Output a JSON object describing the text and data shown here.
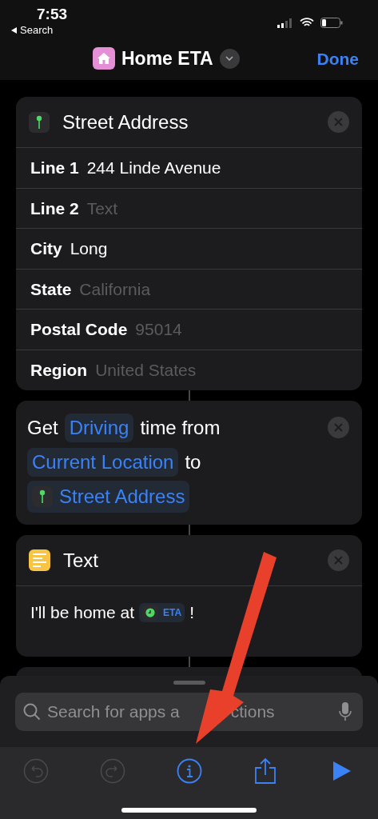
{
  "status_bar": {
    "time": "7:53",
    "back": "Search"
  },
  "nav": {
    "title": "Home ETA",
    "done": "Done"
  },
  "address_card": {
    "title": "Street Address",
    "rows": [
      {
        "label": "Line 1",
        "value": "244 Linde Avenue"
      },
      {
        "label": "Line 2",
        "placeholder": "Text"
      },
      {
        "label": "City",
        "value": "Long"
      },
      {
        "label": "State",
        "placeholder": "California"
      },
      {
        "label": "Postal Code",
        "placeholder": "95014"
      },
      {
        "label": "Region",
        "placeholder": "United States"
      }
    ]
  },
  "travel_card": {
    "lines": [
      [
        {
          "kind": "text",
          "text": "Get"
        },
        {
          "kind": "param",
          "text": "Driving"
        },
        {
          "kind": "text",
          "text": "time from"
        }
      ],
      [
        {
          "kind": "param",
          "text": "Current Location"
        },
        {
          "kind": "text",
          "text": "to"
        }
      ],
      [
        {
          "kind": "variable",
          "text": "Street Address"
        }
      ]
    ]
  },
  "text_card": {
    "title": "Text",
    "body": "I'll be home at",
    "token": "ETA",
    "after": "!"
  },
  "search": {
    "placeholder_visible": [
      "Search for apps a",
      "ctions"
    ]
  },
  "toolbar": [
    {
      "kind": "undo",
      "disabled": true
    },
    {
      "kind": "redo",
      "disabled": true
    },
    {
      "kind": "info",
      "disabled": false
    },
    {
      "kind": "share",
      "disabled": false
    },
    {
      "kind": "play",
      "disabled": false
    }
  ]
}
